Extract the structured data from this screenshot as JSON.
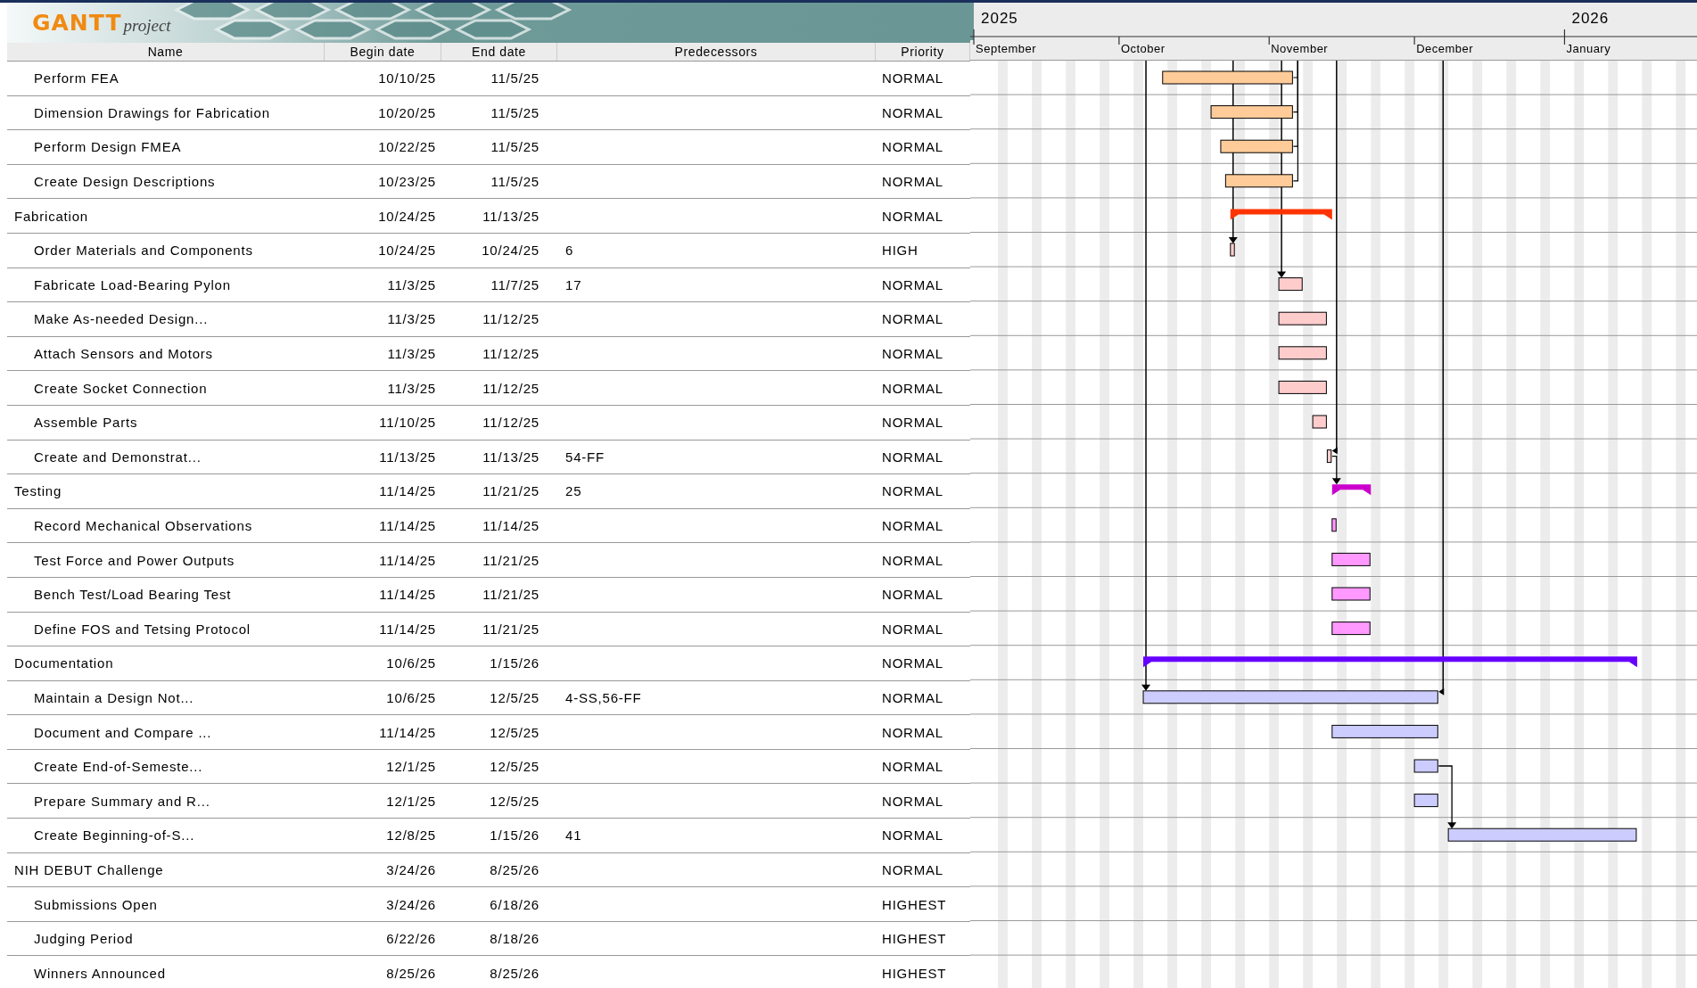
{
  "logo": {
    "title": "GANTT",
    "subtitle": "project"
  },
  "columns": [
    {
      "label": "Name"
    },
    {
      "label": "Begin date"
    },
    {
      "label": "End date"
    },
    {
      "label": "Predecessors"
    },
    {
      "label": "Priority"
    }
  ],
  "timeline": {
    "years": [
      "2025",
      "2026"
    ],
    "months": [
      "September",
      "October",
      "November",
      "December",
      "January"
    ]
  },
  "tasks_continued": [
    {
      "name": "Perform FEA",
      "begin": "10/10/25",
      "end": "11/5/25",
      "priority": "NORMAL",
      "color": "#ffcc99",
      "links": [
        {
          "kind": "out-finish"
        }
      ]
    },
    {
      "name": "Dimension Drawings for Fabrication",
      "begin": "10/20/25",
      "end": "11/5/25",
      "priority": "NORMAL",
      "color": "#ffcc99",
      "links": [
        {
          "kind": "out-finish"
        }
      ]
    },
    {
      "name": "Perform Design FMEA",
      "begin": "10/22/25",
      "end": "11/5/25",
      "priority": "NORMAL",
      "color": "#ffcc99",
      "links": [
        {
          "kind": "out-finish"
        }
      ]
    },
    {
      "name": "Create Design Descriptions",
      "begin": "10/23/25",
      "end": "11/5/25",
      "priority": "NORMAL",
      "color": "#ffcc99",
      "links": [
        {
          "kind": "out-finish"
        }
      ]
    }
  ],
  "tasks": [
    {
      "name": "Fabrication",
      "begin": "10/24/25",
      "end": "11/13/25",
      "priority": "NORMAL",
      "color": "#ff3300",
      "children": [
        {
          "name": "Order Materials and Components",
          "begin": "10/24/25",
          "end": "10/24/25",
          "predecessors": "6",
          "priority": "HIGH",
          "color": "#ffcccc",
          "links": [
            {
              "kind": "in-start"
            }
          ]
        },
        {
          "name": "Fabricate Load-Bearing Pylon",
          "begin": "11/3/25",
          "end": "11/7/25",
          "predecessors": "17",
          "priority": "NORMAL",
          "color": "#ffcccc",
          "links": [
            {
              "kind": "in-start"
            }
          ]
        },
        {
          "name": "Make As-needed Design...",
          "begin": "11/3/25",
          "end": "11/12/25",
          "priority": "NORMAL",
          "color": "#ffcccc"
        },
        {
          "name": "Attach Sensors and Motors",
          "begin": "11/3/25",
          "end": "11/12/25",
          "priority": "NORMAL",
          "color": "#ffcccc"
        },
        {
          "name": "Create Socket Connection",
          "begin": "11/3/25",
          "end": "11/12/25",
          "priority": "NORMAL",
          "color": "#ffcccc"
        },
        {
          "name": "Assemble Parts",
          "begin": "11/10/25",
          "end": "11/12/25",
          "priority": "NORMAL",
          "color": "#ffcccc"
        },
        {
          "name": "Create and Demonstrat...",
          "begin": "11/13/25",
          "end": "11/13/25",
          "predecessors": "54-FF",
          "priority": "NORMAL",
          "color": "#ffcccc",
          "links": [
            {
              "kind": "in-finish"
            }
          ]
        }
      ]
    },
    {
      "name": "Testing",
      "begin": "11/14/25",
      "end": "11/21/25",
      "predecessors": "25",
      "priority": "NORMAL",
      "color": "#cc00cc",
      "links": [
        {
          "kind": "in-start-from-row-above"
        }
      ],
      "children": [
        {
          "name": "Record Mechanical Observations",
          "begin": "11/14/25",
          "end": "11/14/25",
          "priority": "NORMAL",
          "color": "#ff99ff"
        },
        {
          "name": "Test Force and Power Outputs",
          "begin": "11/14/25",
          "end": "11/21/25",
          "priority": "NORMAL",
          "color": "#ff99ff"
        },
        {
          "name": "Bench Test/Load Bearing Test",
          "begin": "11/14/25",
          "end": "11/21/25",
          "priority": "NORMAL",
          "color": "#ff99ff"
        },
        {
          "name": "Define FOS and Tetsing Protocol",
          "begin": "11/14/25",
          "end": "11/21/25",
          "priority": "NORMAL",
          "color": "#ff99ff"
        }
      ]
    },
    {
      "name": "Documentation",
      "begin": "10/6/25",
      "end": "1/15/26",
      "priority": "NORMAL",
      "color": "#6600ff",
      "children": [
        {
          "name": "Maintain a Design Not...",
          "begin": "10/6/25",
          "end": "12/5/25",
          "predecessors": "4-SS,56-FF",
          "priority": "NORMAL",
          "color": "#ccccff",
          "links": [
            {
              "kind": "in-start"
            },
            {
              "kind": "in-finish"
            }
          ]
        },
        {
          "name": "Document and Compare ...",
          "begin": "11/14/25",
          "end": "12/5/25",
          "priority": "NORMAL",
          "color": "#ccccff"
        },
        {
          "name": "Create End-of-Semeste...",
          "begin": "12/1/25",
          "end": "12/5/25",
          "priority": "NORMAL",
          "color": "#ccccff"
        },
        {
          "name": "Prepare Summary and R...",
          "begin": "12/1/25",
          "end": "12/5/25",
          "priority": "NORMAL",
          "color": "#ccccff"
        },
        {
          "name": "Create Beginning-of-S...",
          "begin": "12/8/25",
          "end": "1/15/26",
          "predecessors": "41",
          "priority": "NORMAL",
          "color": "#ccccff",
          "links": [
            {
              "kind": "in-start-from-two-rows-above"
            }
          ]
        }
      ]
    },
    {
      "name": "NIH DEBUT Challenge",
      "begin": "3/24/26",
      "end": "8/25/26",
      "priority": "NORMAL",
      "children": [
        {
          "name": "Submissions Open",
          "begin": "3/24/26",
          "end": "6/18/26",
          "priority": "HIGHEST"
        },
        {
          "name": "Judging Period",
          "begin": "6/22/26",
          "end": "8/18/26",
          "priority": "HIGHEST"
        },
        {
          "name": "Winners Announced",
          "begin": "8/25/26",
          "end": "8/25/26",
          "priority": "HIGHEST"
        }
      ]
    }
  ]
}
